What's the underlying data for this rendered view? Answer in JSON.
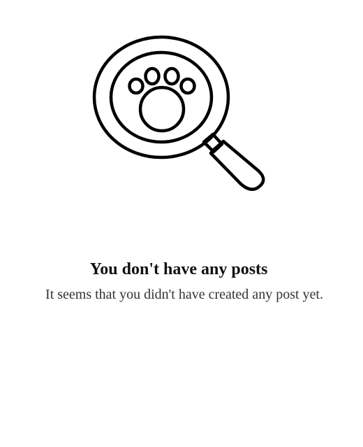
{
  "empty_state": {
    "illustration_icon": "magnifier-paw-icon",
    "title": "You don't have any posts",
    "subtitle": "It seems that you didn't have created any post yet."
  },
  "colors": {
    "background": "#ffffff",
    "stroke": "#000000",
    "title": "#111111",
    "subtitle": "#333333"
  }
}
